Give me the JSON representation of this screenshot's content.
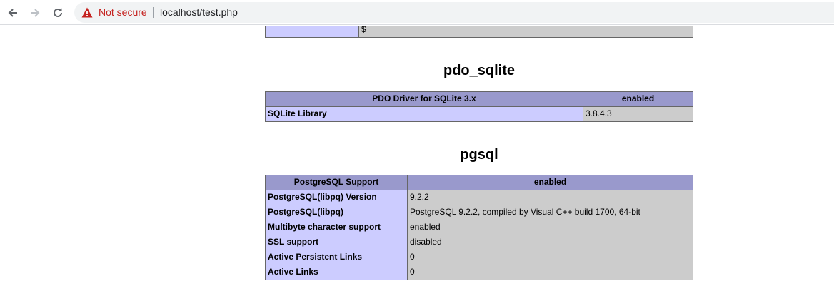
{
  "browser": {
    "security_text": "Not secure",
    "url": "localhost/test.php",
    "warning_color": "#c5221f"
  },
  "top_partial_row": {
    "value": "$"
  },
  "sections": {
    "pdo_sqlite": {
      "title": "pdo_sqlite",
      "header": [
        "PDO Driver for SQLite 3.x",
        "enabled"
      ],
      "rows": [
        {
          "name": "SQLite Library",
          "value": "3.8.4.3"
        }
      ]
    },
    "pgsql": {
      "title": "pgsql",
      "header": [
        "PostgreSQL Support",
        "enabled"
      ],
      "rows": [
        {
          "name": "PostgreSQL(libpq) Version",
          "value": "9.2.2"
        },
        {
          "name": "PostgreSQL(libpq)",
          "value": "PostgreSQL 9.2.2, compiled by Visual C++ build 1700, 64-bit"
        },
        {
          "name": "Multibyte character support",
          "value": "enabled"
        },
        {
          "name": "SSL support",
          "value": "disabled"
        },
        {
          "name": "Active Persistent Links",
          "value": "0"
        },
        {
          "name": "Active Links",
          "value": "0"
        }
      ]
    }
  },
  "colors": {
    "header_bg": "#9999cc",
    "key_bg": "#ccccff",
    "value_bg": "#cccccc"
  }
}
